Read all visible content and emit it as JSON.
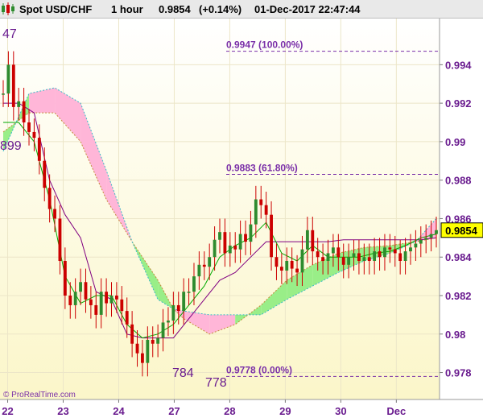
{
  "header": {
    "instrument": "Spot USD/CHF",
    "timeframe": "1 hour",
    "last_price": "0.9854",
    "change": "(+0.14%)",
    "datetime": "01-Dec-2017 22:47:44"
  },
  "watermark": "© ProRealTime.com",
  "colors": {
    "up_candle": "#2e8b2e",
    "down_candle": "#cc0000",
    "wick": "#cc0000",
    "kijun": "#800080",
    "tenkan": "#00aa00",
    "cloud_bull": "#99ee88",
    "cloud_bear": "#ffb6d8",
    "fib_line": "#7a2fa8",
    "price_tag_bg": "#ffff00",
    "axis_text": "#6a1c8f",
    "plot_bg_top": "#ffffff",
    "plot_bg_bottom": "#fbf6c9"
  },
  "chart_data": {
    "type": "line",
    "title": "Spot USD/CHF",
    "xlabel": "",
    "ylabel": "",
    "ylim": [
      0.9766,
      0.9964
    ],
    "grid": true,
    "y_ticks": [
      {
        "value": 0.994,
        "label": "0.994"
      },
      {
        "value": 0.992,
        "label": "0.992"
      },
      {
        "value": 0.99,
        "label": "0.99"
      },
      {
        "value": 0.988,
        "label": "0.988"
      },
      {
        "value": 0.986,
        "label": "0.986"
      },
      {
        "value": 0.984,
        "label": "0.984"
      },
      {
        "value": 0.982,
        "label": "0.982"
      },
      {
        "value": 0.98,
        "label": "0.98"
      },
      {
        "value": 0.978,
        "label": "0.978"
      }
    ],
    "x_ticks": [
      "22",
      "23",
      "24",
      "27",
      "28",
      "29",
      "30",
      "Dec"
    ],
    "fib_levels": [
      {
        "price": 0.9947,
        "label": "0.9947 (100.00%)"
      },
      {
        "price": 0.9883,
        "label": "0.9883 (61.80%)"
      },
      {
        "price": 0.9778,
        "label": "0.9778 (0.00%)"
      }
    ],
    "annotations": [
      {
        "text": "47",
        "ref": 0.9947
      },
      {
        "text": "899",
        "ref": 0.9899
      },
      {
        "text": "784",
        "ref": 0.9784
      },
      {
        "text": "778",
        "ref": 0.9778
      }
    ],
    "last_price": 0.9854,
    "series": [
      {
        "name": "",
        "kind": "close",
        "x": [
          0,
          2,
          4,
          6,
          8,
          10,
          12,
          14,
          16,
          18,
          20,
          22,
          24,
          26,
          28,
          30,
          32,
          34,
          36,
          38,
          40,
          42,
          44,
          46,
          48,
          50,
          52,
          54,
          56,
          58,
          60,
          62,
          64,
          66,
          68,
          70,
          72,
          74,
          76,
          78,
          80,
          82,
          84,
          86,
          88,
          90,
          92,
          94,
          96,
          98,
          100,
          102,
          104,
          106,
          108,
          110,
          112,
          114,
          116,
          118,
          120,
          122,
          124,
          126,
          128,
          130,
          132,
          134,
          136,
          138,
          140,
          142,
          144,
          146,
          148,
          150,
          152,
          154,
          156,
          158,
          160,
          162,
          164,
          166,
          168
        ],
        "values": [
          0.9925,
          0.994,
          0.9918,
          0.9921,
          0.991,
          0.9905,
          0.9902,
          0.989,
          0.9876,
          0.9865,
          0.986,
          0.9838,
          0.982,
          0.9815,
          0.9822,
          0.9827,
          0.9818,
          0.9815,
          0.981,
          0.9822,
          0.9816,
          0.982,
          0.9818,
          0.9812,
          0.9805,
          0.9795,
          0.979,
          0.9785,
          0.9797,
          0.9795,
          0.9798,
          0.9806,
          0.9807,
          0.9815,
          0.9812,
          0.9822,
          0.9822,
          0.983,
          0.9836,
          0.9835,
          0.984,
          0.9849,
          0.9853,
          0.9842,
          0.9846,
          0.9844,
          0.9852,
          0.9848,
          0.9857,
          0.987,
          0.9867,
          0.9862,
          0.984,
          0.9835,
          0.9833,
          0.9838,
          0.9834,
          0.9832,
          0.9844,
          0.9854,
          0.9843,
          0.984,
          0.9838,
          0.9842,
          0.9845,
          0.984,
          0.9836,
          0.984,
          0.9842,
          0.9838,
          0.984,
          0.9838,
          0.9843,
          0.984,
          0.9845,
          0.9844,
          0.9842,
          0.9838,
          0.9843,
          0.9845,
          0.9847,
          0.9849,
          0.985,
          0.9852,
          0.9854
        ]
      },
      {
        "name": "",
        "kind": "tenkan",
        "x": [
          0,
          6,
          12,
          18,
          24,
          30,
          36,
          42,
          48,
          54,
          60,
          66,
          72,
          78,
          84,
          90,
          96,
          102,
          108,
          114,
          120,
          126,
          132,
          138,
          144,
          150,
          156,
          162,
          168
        ],
        "values": [
          0.991,
          0.991,
          0.99,
          0.987,
          0.983,
          0.9816,
          0.982,
          0.982,
          0.9805,
          0.9798,
          0.98,
          0.9805,
          0.9815,
          0.9825,
          0.984,
          0.9846,
          0.985,
          0.9858,
          0.9842,
          0.9838,
          0.9846,
          0.984,
          0.984,
          0.984,
          0.9842,
          0.9843,
          0.9846,
          0.985,
          0.9852
        ]
      },
      {
        "name": "",
        "kind": "kijun",
        "x": [
          0,
          6,
          12,
          18,
          24,
          30,
          36,
          42,
          48,
          54,
          60,
          66,
          72,
          78,
          84,
          90,
          96,
          102,
          108,
          114,
          120,
          126,
          132,
          138,
          144,
          150,
          156,
          162,
          168
        ],
        "values": [
          0.992,
          0.992,
          0.9915,
          0.988,
          0.9862,
          0.985,
          0.9822,
          0.9818,
          0.98,
          0.9798,
          0.9798,
          0.9798,
          0.9808,
          0.9818,
          0.9828,
          0.9832,
          0.984,
          0.9848,
          0.9848,
          0.9848,
          0.9848,
          0.9848,
          0.9849,
          0.9849,
          0.9849,
          0.9849,
          0.9849,
          0.9849,
          0.985
        ]
      },
      {
        "name": "",
        "kind": "span_a",
        "x": [
          0,
          10,
          20,
          30,
          40,
          50,
          60,
          66,
          70,
          80,
          90,
          100,
          110,
          120,
          130,
          140,
          150,
          160,
          168
        ],
        "values": [
          0.9905,
          0.9915,
          0.9915,
          0.99,
          0.987,
          0.9848,
          0.9828,
          0.9813,
          0.9808,
          0.98,
          0.9805,
          0.9815,
          0.9828,
          0.9836,
          0.9842,
          0.9845,
          0.9846,
          0.9848,
          0.985
        ]
      },
      {
        "name": "",
        "kind": "span_b",
        "x": [
          0,
          10,
          20,
          30,
          40,
          50,
          60,
          66,
          70,
          80,
          90,
          100,
          110,
          120,
          130,
          140,
          150,
          160,
          168
        ],
        "values": [
          0.9895,
          0.9925,
          0.9928,
          0.992,
          0.9885,
          0.9848,
          0.9818,
          0.9813,
          0.9812,
          0.981,
          0.981,
          0.981,
          0.9818,
          0.9825,
          0.9832,
          0.9838,
          0.9842,
          0.9848,
          0.986
        ]
      }
    ]
  }
}
